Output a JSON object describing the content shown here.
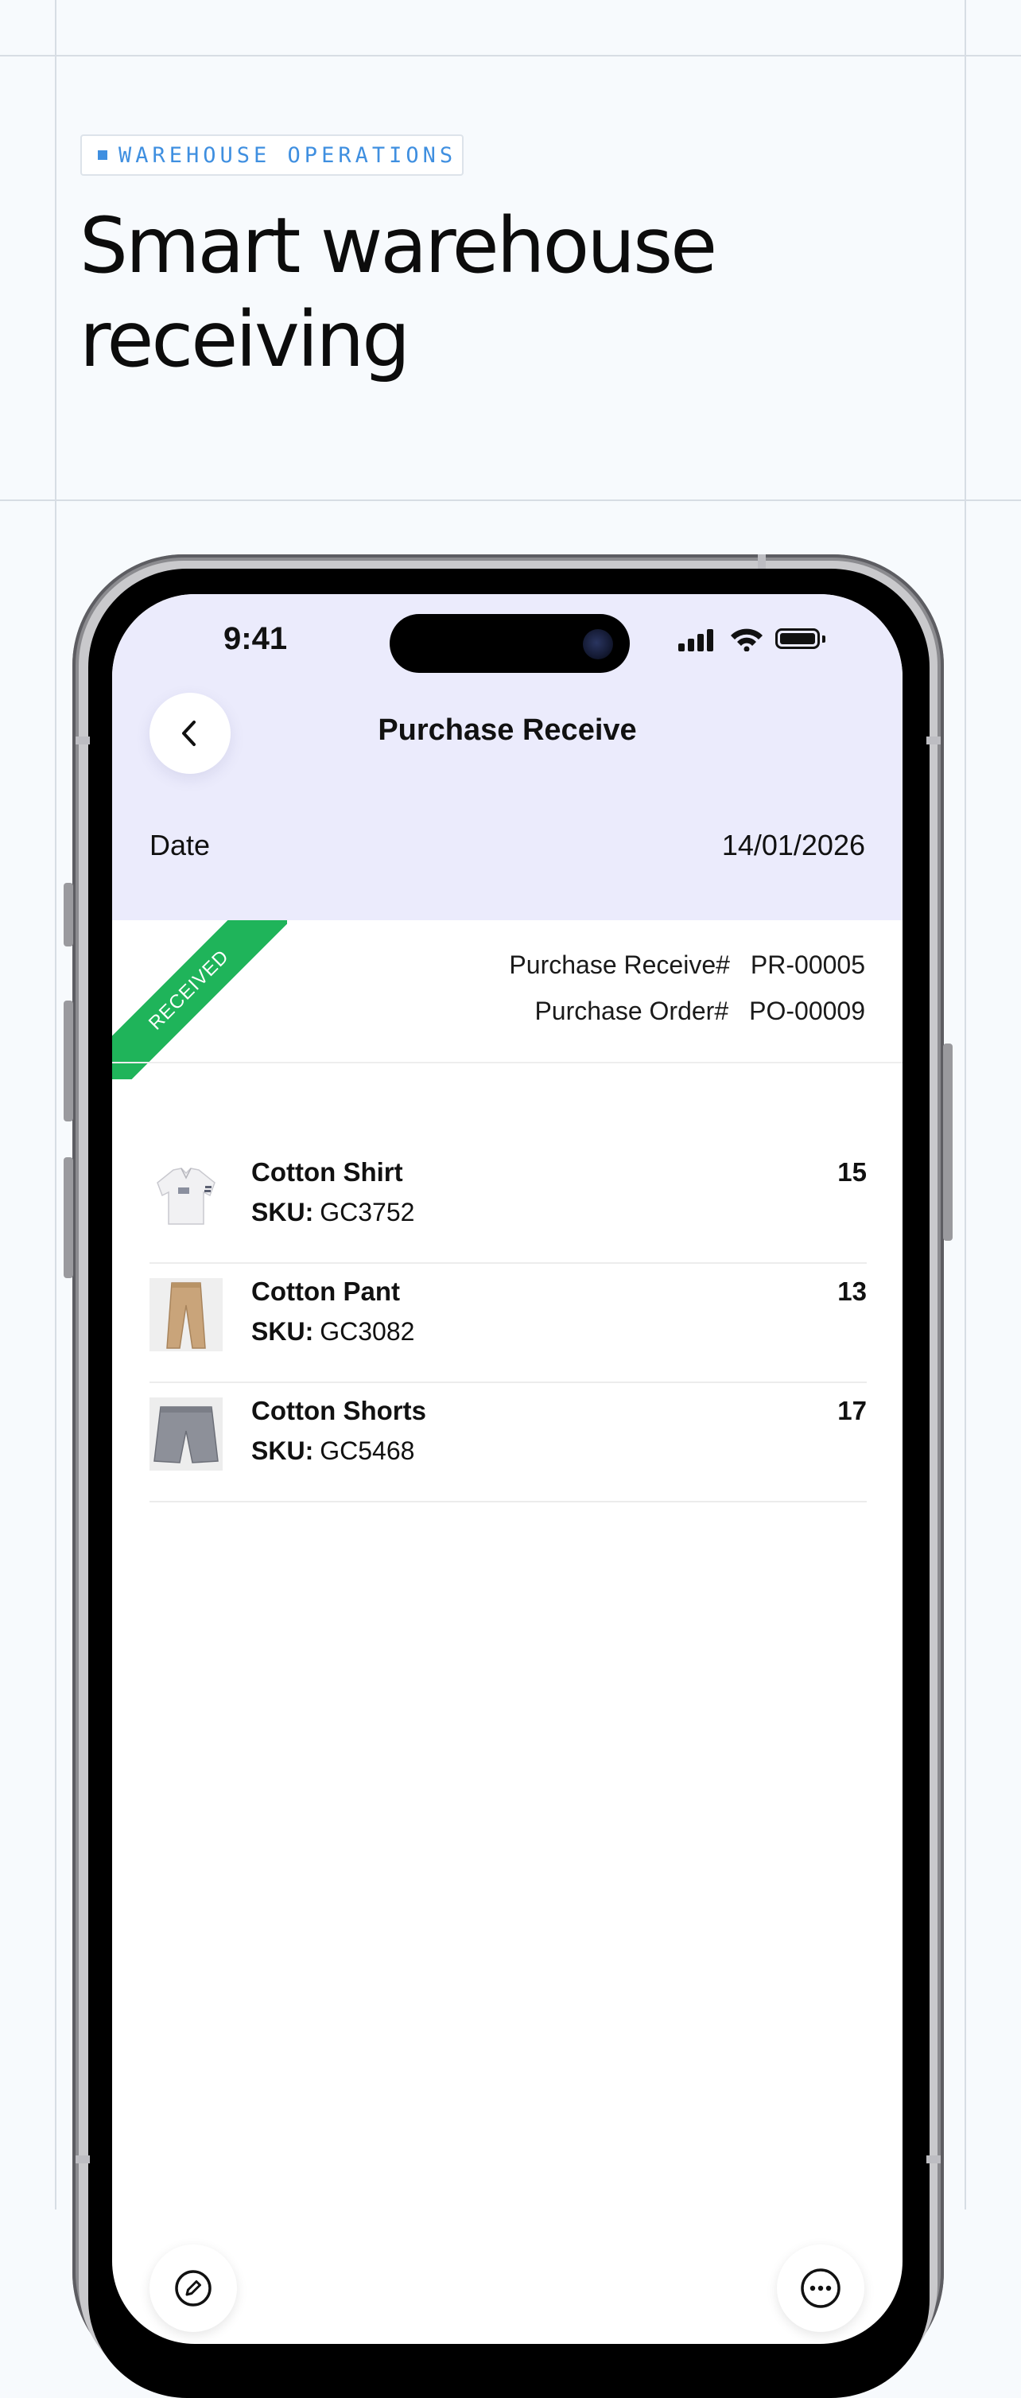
{
  "hero": {
    "tag": "WAREHOUSE OPERATIONS",
    "title": "Smart warehouse receiving"
  },
  "status_bar": {
    "time": "9:41"
  },
  "header": {
    "title": "Purchase Receive",
    "date_label": "Date",
    "date_value": "14/01/2026"
  },
  "receipt": {
    "status": "RECEIVED",
    "purchase_receive_label": "Purchase Receive#",
    "purchase_receive_value": "PR-00005",
    "purchase_order_label": "Purchase Order#",
    "purchase_order_value": "PO-00009"
  },
  "items": [
    {
      "name": "Cotton Shirt",
      "sku_label": "SKU:",
      "sku": "GC3752",
      "qty": "15"
    },
    {
      "name": "Cotton Pant",
      "sku_label": "SKU:",
      "sku": "GC3082",
      "qty": "13"
    },
    {
      "name": "Cotton Shorts",
      "sku_label": "SKU:",
      "sku": "GC5468",
      "qty": "17"
    }
  ],
  "colors": {
    "accent": "#3f8fe0",
    "header_bg": "#ebebfc",
    "received_green": "#1fb45a"
  },
  "icons": {
    "back": "chevron-left-icon",
    "edit": "pencil-icon",
    "more": "more-icon"
  }
}
